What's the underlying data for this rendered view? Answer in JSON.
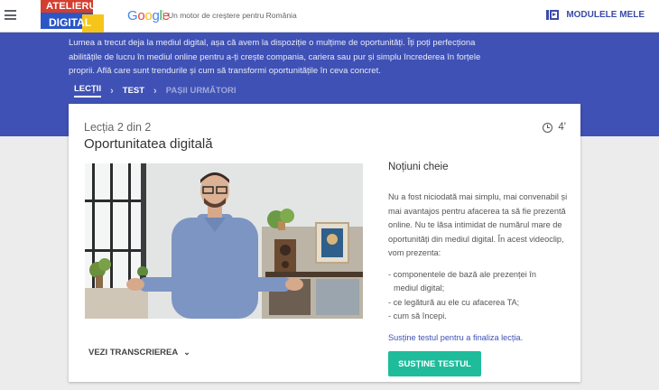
{
  "topbar": {
    "logo": {
      "line1": "ATELIERUL",
      "line2": "DIGITAL"
    },
    "google": [
      "G",
      "o",
      "o",
      "g",
      "l",
      "e"
    ],
    "google_colors": [
      "#4285f4",
      "#ea4335",
      "#fbbc05",
      "#4285f4",
      "#34a853",
      "#ea4335"
    ],
    "tagline": "Un motor de creștere pentru România",
    "modules_label": "MODULELE MELE"
  },
  "hero": {
    "intro": "Lumea a trecut deja la mediul digital, așa că avem la dispoziție o mulțime de oportunități. Îți poți perfecționa abilitățile de lucru în mediul online pentru a-ți crește compania, cariera sau pur și simplu încrederea în forțele proprii. Află care sunt trendurile și cum să transformi oportunitățile în ceva concret.",
    "steps": [
      "LECȚII",
      "TEST",
      "PAȘII URMĂTORI"
    ]
  },
  "lesson": {
    "number": "Lecția 2 din 2",
    "title": "Oportunitatea digitală",
    "duration": "4'",
    "transcript_label": "VEZI TRANSCRIEREA"
  },
  "side": {
    "heading": "Noțiuni cheie",
    "paragraph": "Nu a fost niciodată mai simplu, mai convenabil și mai avantajos pentru afacerea ta să fie prezentă online. Nu te lăsa intimidat de numărul mare de oportunități din mediul digital. În acest videoclip, vom prezenta:",
    "bullets": [
      "- componentele de bază ale prezenței în",
      "mediul digital;",
      "- ce legătură au ele cu afacerea TA;",
      "- cum să începi."
    ],
    "link": "Susține testul pentru a finaliza lecția.",
    "button": "SUSȚINE TESTUL"
  },
  "colors": {
    "hero_bg": "#3f51b5",
    "accent": "#1fbc9c",
    "link": "#3f51b5"
  }
}
